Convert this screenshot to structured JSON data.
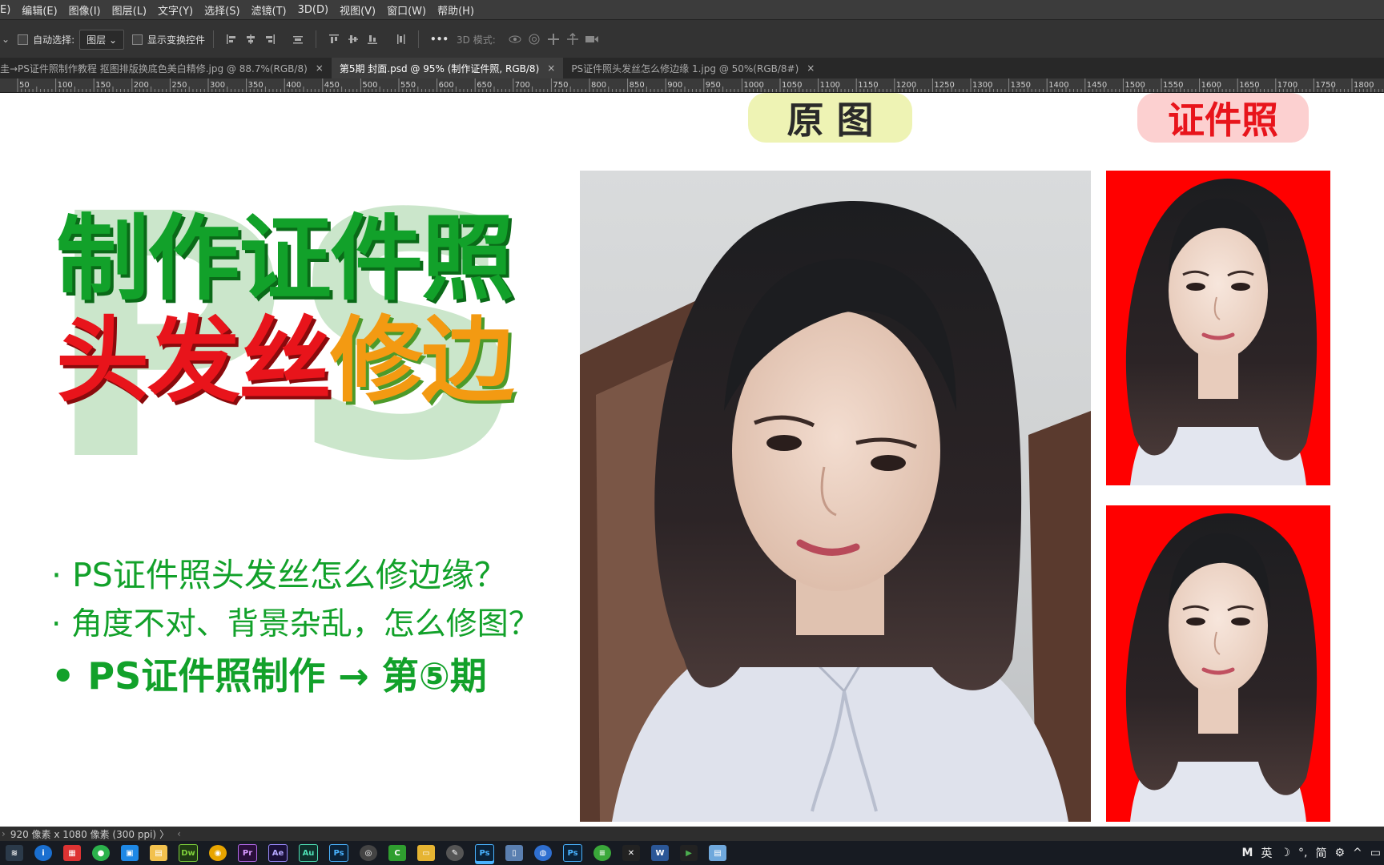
{
  "menu": [
    "E)",
    "编辑(E)",
    "图像(I)",
    "图层(L)",
    "文字(Y)",
    "选择(S)",
    "滤镜(T)",
    "3D(D)",
    "视图(V)",
    "窗口(W)",
    "帮助(H)"
  ],
  "options": {
    "auto_select_label": "自动选择:",
    "auto_select_value": "图层",
    "show_transform_label": "显示变换控件",
    "more_label": "•••",
    "mode_3d_label": "3D 模式:"
  },
  "tabs": [
    {
      "label": "圭→PS证件照制作教程 抠图排版换底色美白精修.jpg @ 88.7%(RGB/8)",
      "close": "×"
    },
    {
      "label": "第5期 封面.psd @ 95% (制作证件照, RGB/8)",
      "close": "×"
    },
    {
      "label": "PS证件照头发丝怎么修边缘 1.jpg @ 50%(RGB/8#)",
      "close": "×"
    }
  ],
  "ruler_labels": [
    "50",
    "100",
    "150",
    "200",
    "250",
    "300",
    "350",
    "400",
    "450",
    "500",
    "550",
    "600",
    "650",
    "700",
    "750",
    "800",
    "850",
    "900",
    "950",
    "1000",
    "1050",
    "1100",
    "1150",
    "1200",
    "1250",
    "1300",
    "1350",
    "1400",
    "1450",
    "1500",
    "1550",
    "1600",
    "1650",
    "1700",
    "1750",
    "1800"
  ],
  "canvas": {
    "watermark": "PS",
    "title_line1": "制作证件照",
    "title_line2_red": "头发丝",
    "title_line2_orange": "修边",
    "bullets": [
      "· PS证件照头发丝怎么修边缘？",
      "· 角度不对、背景杂乱，怎么修图？",
      "• PS证件照制作 → 第⑤期"
    ],
    "label_original": "原 图",
    "label_id_photo": "证件照"
  },
  "colors": {
    "green": "#12a12a",
    "red": "#e8141b",
    "orange": "#f39a12",
    "watermark": "#cbe6cb",
    "id_background": "#ff0000",
    "pill_yellow": "#eef3b4",
    "pill_pink": "#fcd0d0"
  },
  "status": {
    "size_text": "920 像素 x 1080 像素 (300 ppi)",
    "arrow": "〉",
    "left_arrow": "‹"
  },
  "taskbar": {
    "apps": [
      "Dw",
      "Pr",
      "Ae",
      "Au",
      "Ps",
      "Ps",
      "Ps"
    ],
    "tray": [
      "M",
      "英",
      "☽",
      "°,",
      "简",
      "⚙",
      "^"
    ]
  }
}
